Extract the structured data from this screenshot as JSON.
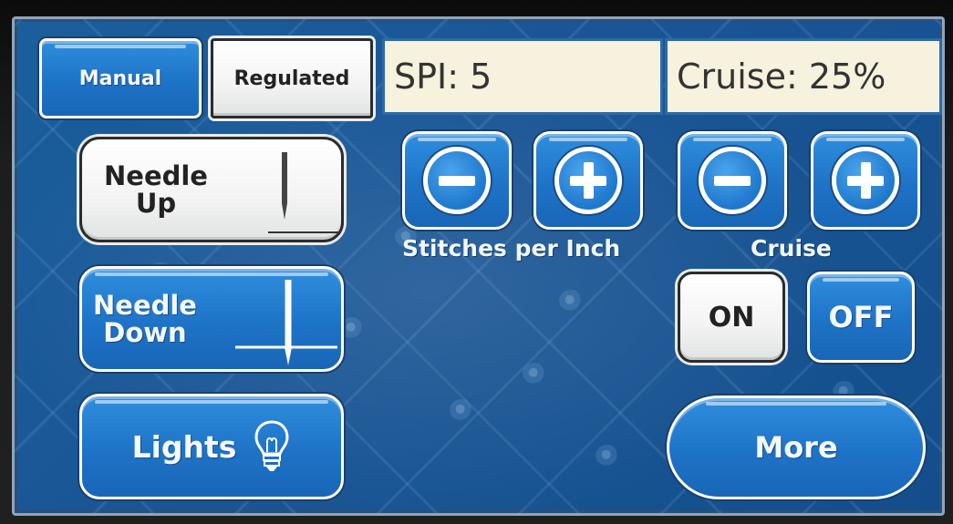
{
  "mode_buttons": {
    "manual_label": "Manual",
    "regulated_label": "Regulated"
  },
  "readouts": {
    "spi": "SPI: 5",
    "cruise": "Cruise: 25%"
  },
  "needle_up": {
    "line1": "Needle",
    "line2": "Up"
  },
  "needle_down": {
    "line1": "Needle",
    "line2": "Down"
  },
  "lights_label": "Lights",
  "stitches_per_inch_label": "Stitches per Inch",
  "cruise_label": "Cruise",
  "cruise_on_label": "ON",
  "cruise_off_label": "OFF",
  "more_label": "More",
  "icons": {
    "minus": "minus-icon",
    "plus": "plus-icon",
    "needle": "needle-icon",
    "bulb": "light-bulb-icon"
  },
  "colors": {
    "background_blue": "#1a5696",
    "button_blue": "#1e73c7",
    "selected_button": "#f2f3f2",
    "readout_bg": "#f6f2de"
  }
}
